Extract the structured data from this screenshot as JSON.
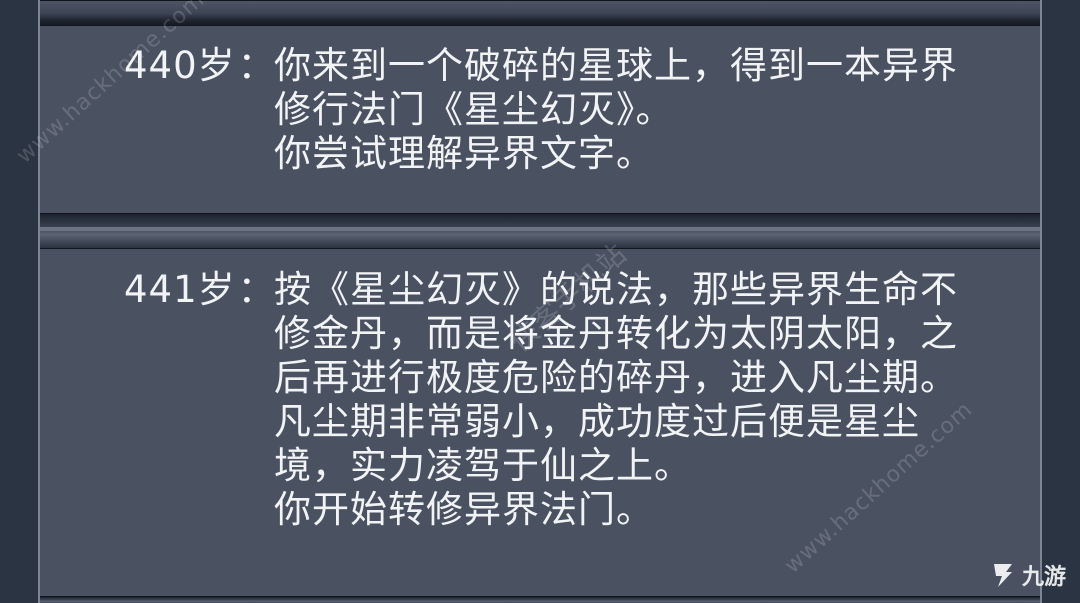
{
  "entries": [
    {
      "age": "440岁",
      "colon": "：",
      "lines": [
        "你来到一个破碎的星球上，得到一本异界",
        "修行法门《星尘幻灭》。",
        "你尝试理解异界文字。"
      ]
    },
    {
      "age": "441岁",
      "colon": "：",
      "lines": [
        "按《星尘幻灭》的说法，那些异界生命不",
        "修金丹，而是将金丹转化为太阴太阳，之",
        "后再进行极度危险的碎丹，进入凡尘期。",
        "凡尘期非常弱小，成功度过后便是星尘",
        "境，实力凌驾于仙之上。",
        "你开始转修异界法门。"
      ]
    }
  ],
  "watermarks": {
    "wm1": "www.hackhome.com",
    "wm2": "侠客手机站",
    "wm3": "www.hackhome.com"
  },
  "brand": {
    "text": "九游",
    "logo_icon": "nine-game-logo-icon"
  }
}
